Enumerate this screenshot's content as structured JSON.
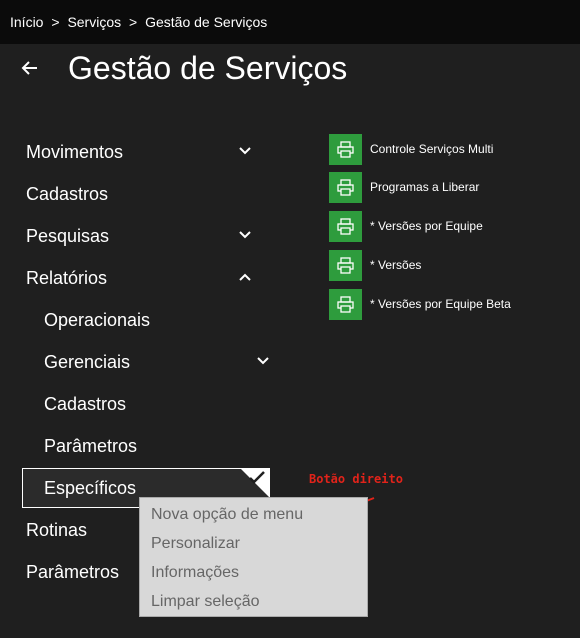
{
  "breadcrumb": [
    "Início",
    ">",
    "Serviços",
    ">",
    "Gestão de Serviços"
  ],
  "page_title": "Gestão de Serviços",
  "menu": {
    "items": [
      {
        "label": "Movimentos",
        "chevron": "down"
      },
      {
        "label": "Cadastros",
        "chevron": ""
      },
      {
        "label": "Pesquisas",
        "chevron": "down"
      },
      {
        "label": "Relatórios",
        "chevron": "up"
      },
      {
        "label": "Rotinas",
        "chevron": ""
      },
      {
        "label": "Parâmetros",
        "chevron": ""
      }
    ],
    "sub_items": [
      {
        "label": "Operacionais",
        "chevron": ""
      },
      {
        "label": "Gerenciais",
        "chevron": "down"
      },
      {
        "label": "Cadastros",
        "chevron": ""
      },
      {
        "label": "Parâmetros",
        "chevron": ""
      },
      {
        "label": "Específicos",
        "chevron": "",
        "selected": true
      }
    ]
  },
  "reports": [
    {
      "label": "Controle Serviços Multi",
      "icon": "printer-icon"
    },
    {
      "label": "Programas a Liberar",
      "icon": "printer-icon"
    },
    {
      "label": "* Versões por Equipe",
      "icon": "printer-icon"
    },
    {
      "label": "* Versões",
      "icon": "printer-icon"
    },
    {
      "label": "* Versões por Equipe Beta",
      "icon": "printer-icon"
    }
  ],
  "annotation": "Botão direito",
  "context_menu": [
    "Nova opção de menu",
    "Personalizar",
    "Informações",
    "Limpar seleção"
  ],
  "colors": {
    "background": "#1f1f1f",
    "topbar": "#0b0b0b",
    "tile_green": "#2e9c3d",
    "annotation_red": "#e2231a",
    "context_bg": "#d8d8d8",
    "context_text": "#666666"
  }
}
